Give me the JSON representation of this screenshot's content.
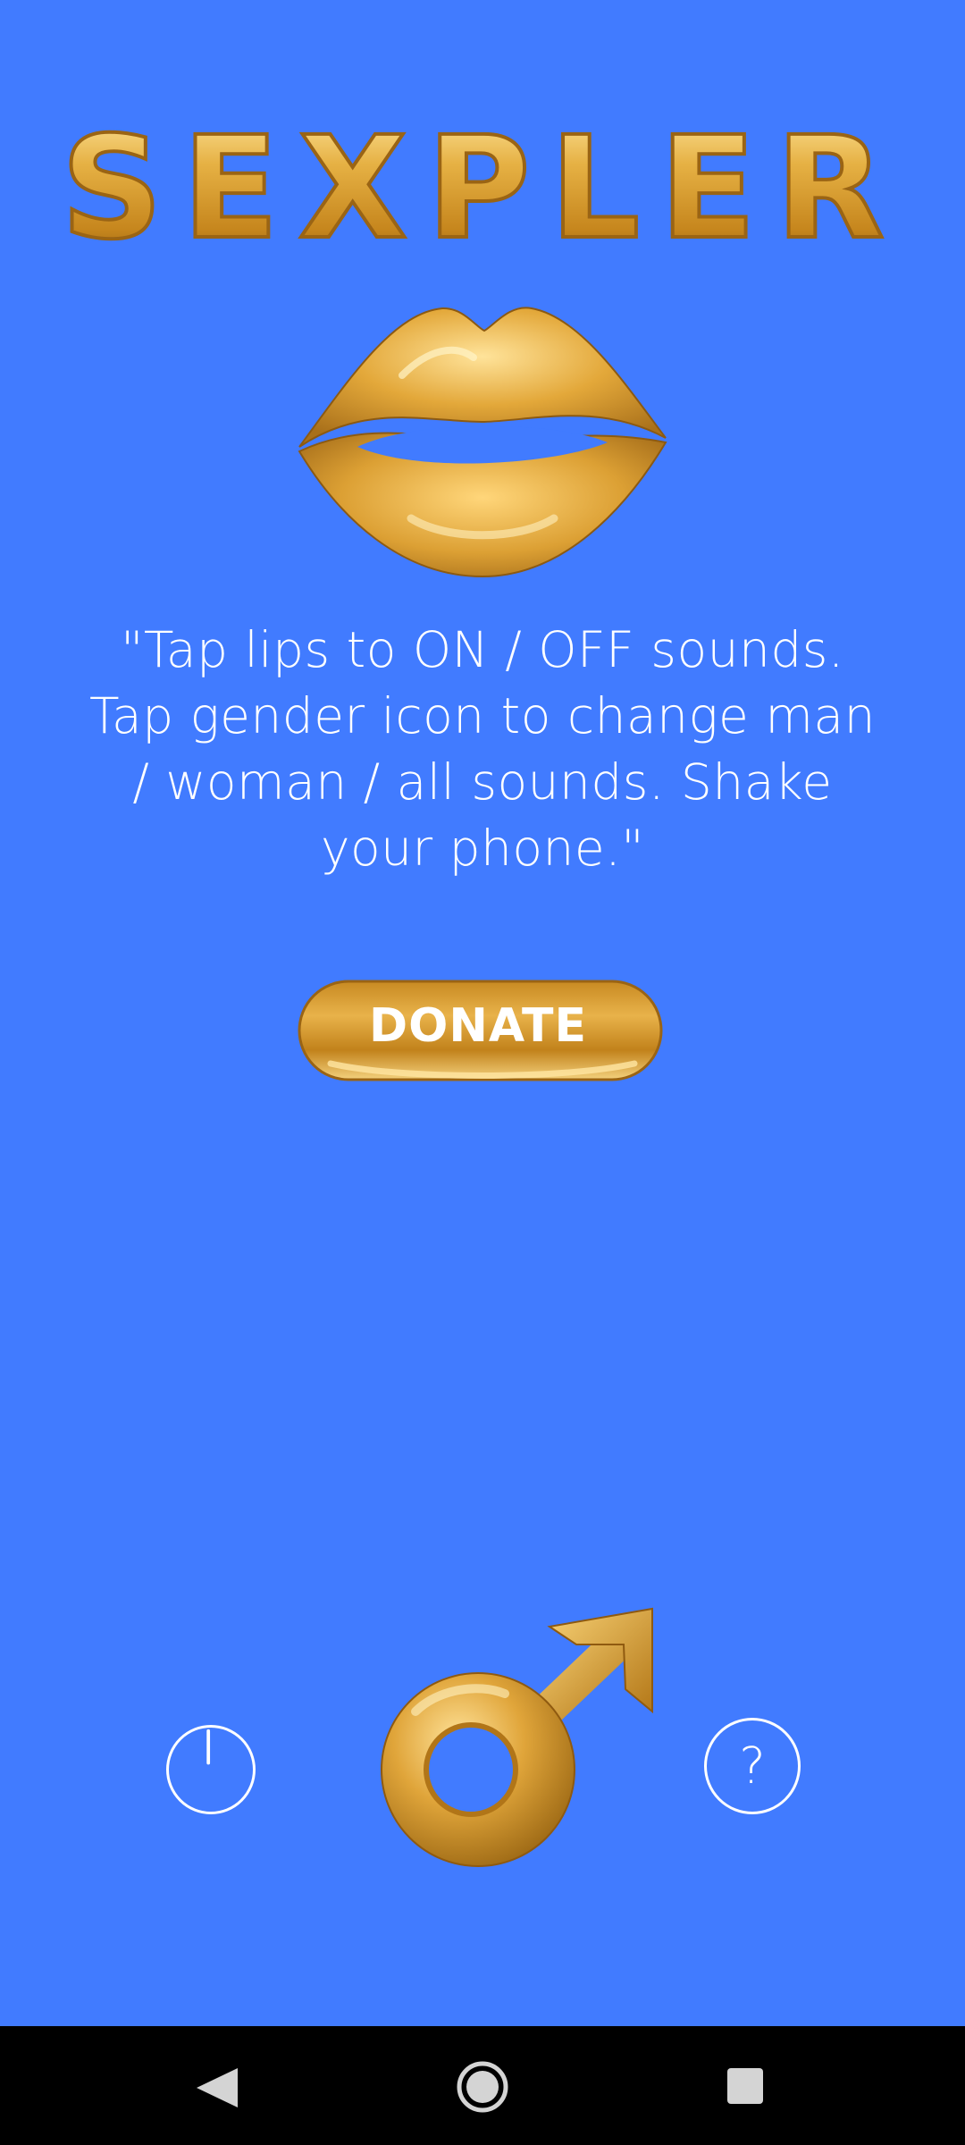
{
  "app": {
    "logo_text": "SEXPLER",
    "instructions": "\"Tap lips to ON / OFF sounds. Tap gender icon to change man / woman / all sounds. Shake your phone.\"",
    "donate_label": "DONATE",
    "help_label": "?"
  },
  "icons": {
    "lips": "lips-icon",
    "gender": "male-symbol-icon",
    "power": "power-icon",
    "help": "question-icon"
  },
  "navbar": {
    "back": "back-triangle-icon",
    "home": "home-circle-icon",
    "recents": "recents-square-icon"
  },
  "colors": {
    "background": "#417bff",
    "gold": "#d9a233",
    "text": "#ffffff",
    "navbar": "#000000"
  }
}
